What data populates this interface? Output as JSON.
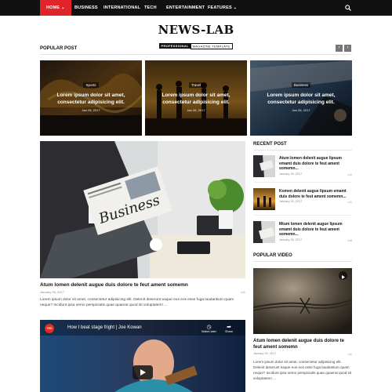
{
  "nav": {
    "items": [
      {
        "label": "HOME ⌄",
        "active": true
      },
      {
        "label": "BUSINESS"
      },
      {
        "label": "INTERNATIONAL"
      },
      {
        "label": "TECH"
      },
      {
        "label": "ENTERTAINMENT"
      },
      {
        "label": "FEATURES ⌄"
      }
    ],
    "search_icon": "search-icon"
  },
  "logo": {
    "title": "NEWS-LAB",
    "tag_a": "PROFESSIONAL",
    "tag_b": "MAGAZINE TEMPLATE"
  },
  "popular": {
    "heading": "POPULAR POST",
    "prev_label": "‹",
    "next_label": "›",
    "cards": [
      {
        "category": "Sports",
        "title": "Lorem ipsum dolor sit amet, consectetur adipisicing elit.",
        "date": "Jan 26, 2017"
      },
      {
        "category": "Travel",
        "title": "Lorem ipsum dolor sit amet, consectetur adipisicing elit.",
        "date": "Jan 26, 2017"
      },
      {
        "category": "Business",
        "title": "Lorem ipsum dolor sit amet, consectetur adipisicing elit.",
        "date": "Jan 26, 2017"
      }
    ]
  },
  "main": {
    "title": "Atum lomen delenit augue duis dolore te feut ament somemn",
    "date": "January 25, 2017",
    "comments": "1",
    "excerpt": "Lorem ipsum dolor sit amet, consectetur adipisicing elit. Delenit deserunt eaque eus eos esse fuga laudantium quam neque? Incidunt ipsa nemo perspiciatis quae quaerat quod sit voluptatem! ...",
    "video": {
      "badge": "TED",
      "title": "How I beat stage fright | Joe Kowan",
      "watch_later": "Watch later",
      "share": "Share"
    }
  },
  "sidebar": {
    "recent_heading": "RECENT POST",
    "recent": [
      {
        "title": "Atum lomen delenit augue lipsum emamt duis dolore te feut ament somemn...",
        "date": "January 25, 2017",
        "comments": "1"
      },
      {
        "title": "Komen delenit augue lipsum emamt duis dolore te feut ament somemn...",
        "date": "January 25, 2017",
        "comments": "1"
      },
      {
        "title": "Mtum lomen delenit augue lipsum emamt duis dolore te feut ament somemn...",
        "date": "January 25, 2017",
        "comments": "0"
      }
    ],
    "video_heading": "POPULAR VIDEO",
    "video": {
      "title": "Atum lomen delenit augue duis dolore te feut ament somemn",
      "date": "January 25, 2017",
      "comments": "1",
      "excerpt": "Lorem ipsum dolor sit amet, consectetur adipisicing elit. Delenit deserunt eaque eus eos esse fuga laudantium quam neque? Incidunt ipsa nemo perspiciatis quae quaerat quod sit voluptatem! ..."
    }
  },
  "colors": {
    "accent": "#e0242b",
    "nav_bg": "#111111",
    "text": "#222222",
    "muted": "#888888"
  }
}
